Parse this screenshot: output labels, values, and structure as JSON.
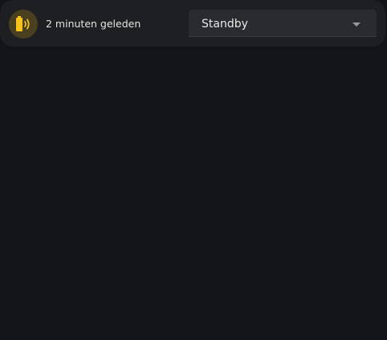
{
  "entity": {
    "icon": "battery-sound-icon",
    "icon_color": "#f6c21c",
    "last_changed": "2 minuten geleden"
  },
  "select": {
    "value": "Standby",
    "arrow_icon": "menu-down-icon"
  },
  "colors": {
    "background": "#131417",
    "card": "#1e1f23",
    "select_background": "#2a2b30",
    "icon_badge": "#4a3f1e"
  }
}
